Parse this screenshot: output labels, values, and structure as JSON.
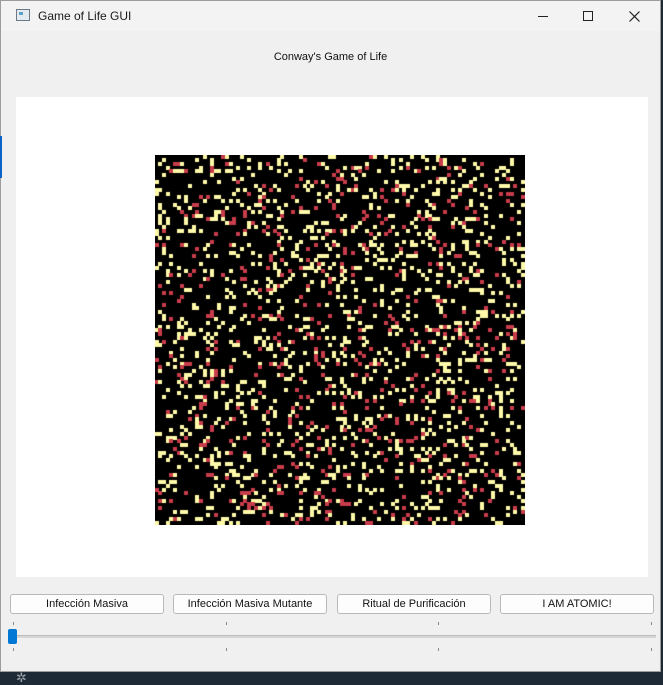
{
  "window": {
    "title": "Game of Life GUI",
    "controls": {
      "minimize": "minimize",
      "maximize": "maximize",
      "close": "close"
    }
  },
  "header": {
    "title": "Conway's Game of Life"
  },
  "grid": {
    "cells_per_side": 100,
    "colors": {
      "dead": "#000000",
      "alive": "#fffaaa",
      "mutant": "#c83c4b"
    },
    "alive_fraction": 0.14,
    "mutant_fraction": 0.05
  },
  "actions": {
    "infeccion_masiva": "Infección Masiva",
    "infeccion_mutante": "Infección Masiva Mutante",
    "ritual_purificacion": "Ritual de Purificación",
    "atomic": "I AM ATOMIC!"
  },
  "sliders": [
    {
      "name": "speed-slider",
      "value": 0.0
    },
    {
      "name": "secondary-slider",
      "value": 0.0
    }
  ],
  "colors": {
    "accent": "#0078d4",
    "panel": "#ffffff",
    "window": "#f0f0f0"
  }
}
